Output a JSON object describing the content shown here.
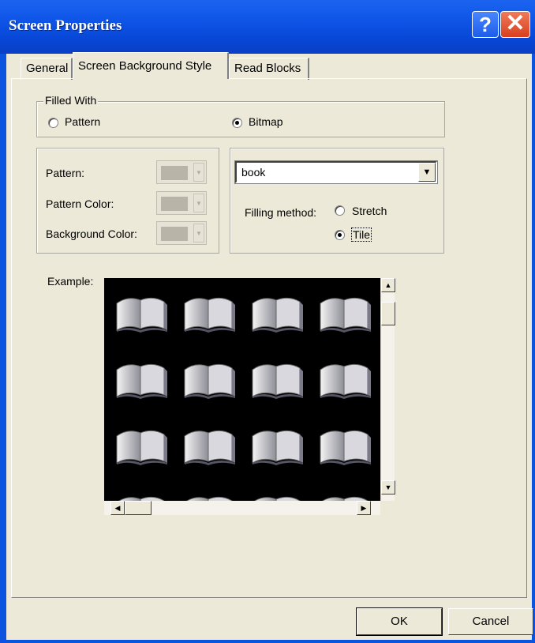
{
  "window": {
    "title": "Screen Properties"
  },
  "tabs": [
    {
      "label": "General",
      "active": false
    },
    {
      "label": "Screen Background Style",
      "active": true
    },
    {
      "label": "Read Blocks",
      "active": false
    }
  ],
  "filled_with": {
    "legend": "Filled With",
    "options": [
      {
        "label": "Pattern",
        "selected": false
      },
      {
        "label": "Bitmap",
        "selected": true
      }
    ]
  },
  "pattern_group": {
    "pattern_label": "Pattern:",
    "pattern_color_label": "Pattern Color:",
    "background_color_label": "Background Color:"
  },
  "bitmap_group": {
    "bitmap_value": "book",
    "filling_method_label": "Filling method:",
    "options": [
      {
        "label": "Stretch",
        "selected": false
      },
      {
        "label": "Tile",
        "selected": true
      }
    ]
  },
  "example": {
    "label": "Example:"
  },
  "buttons": {
    "ok": "OK",
    "cancel": "Cancel"
  }
}
